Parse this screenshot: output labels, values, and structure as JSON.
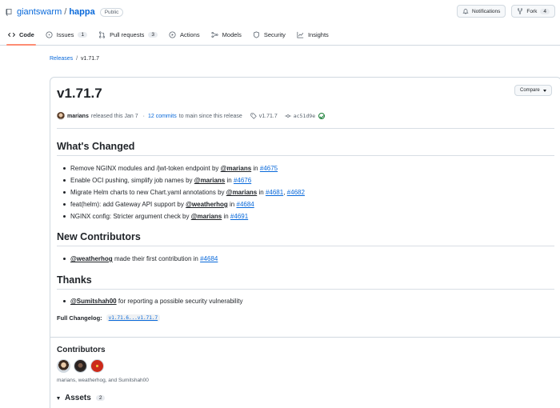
{
  "repo": {
    "owner": "giantswarm",
    "separator": "/",
    "name": "happa",
    "visibility": "Public"
  },
  "top_actions": {
    "notifications": "Notifications",
    "fork": "Fork",
    "fork_count": "4"
  },
  "tabs": [
    {
      "label": "Code",
      "active": true
    },
    {
      "label": "Issues",
      "count": "1"
    },
    {
      "label": "Pull requests",
      "count": "3"
    },
    {
      "label": "Actions"
    },
    {
      "label": "Models"
    },
    {
      "label": "Security"
    },
    {
      "label": "Insights"
    }
  ],
  "breadcrumb": {
    "releases": "Releases",
    "separator": "/",
    "current": "v1.71.7"
  },
  "release": {
    "title": "v1.71.7",
    "compare_label": "Compare",
    "author": "marians",
    "released_text": "released this Jan 7",
    "dot": "·",
    "commits_link": "12 commits",
    "commits_suffix": "to main since this release",
    "tag": "v1.71.7",
    "commit": "ac51d9e"
  },
  "whats_changed": {
    "heading": "What's Changed",
    "items": [
      {
        "text": "Remove NGINX modules and /jwt-token endpoint by",
        "mention": "@marians",
        "in": "in",
        "pr": "#4675"
      },
      {
        "text": "Enable OCI pushing, simplify job names by",
        "mention": "@marians",
        "in": "in",
        "pr": "#4676"
      },
      {
        "text": "Migrate Helm charts to new Chart.yaml annotations by",
        "mention": "@marians",
        "in": "in",
        "pr": "#4681",
        "comma": ",",
        "pr2": "#4682"
      },
      {
        "text": "feat(helm): add Gateway API support by",
        "mention": "@weatherhog",
        "in": "in",
        "pr": "#4684"
      },
      {
        "text": "NGINX config: Stricter argument check by",
        "mention": "@marians",
        "in": "in",
        "pr": "#4691"
      }
    ]
  },
  "new_contributors": {
    "heading": "New Contributors",
    "items": [
      {
        "mention": "@weatherhog",
        "text": "made their first contribution in",
        "pr": "#4684"
      }
    ]
  },
  "thanks": {
    "heading": "Thanks",
    "items": [
      {
        "mention": "@Sumitshah00",
        "text": "for reporting a possible security vulnerability"
      }
    ]
  },
  "changelog": {
    "label": "Full Changelog:",
    "link": "v1.71.6...v1.71.7"
  },
  "contributors": {
    "heading": "Contributors",
    "names": "marians, weatherhog, and Sumitshah00"
  },
  "assets": {
    "heading": "Assets",
    "count": "2"
  }
}
